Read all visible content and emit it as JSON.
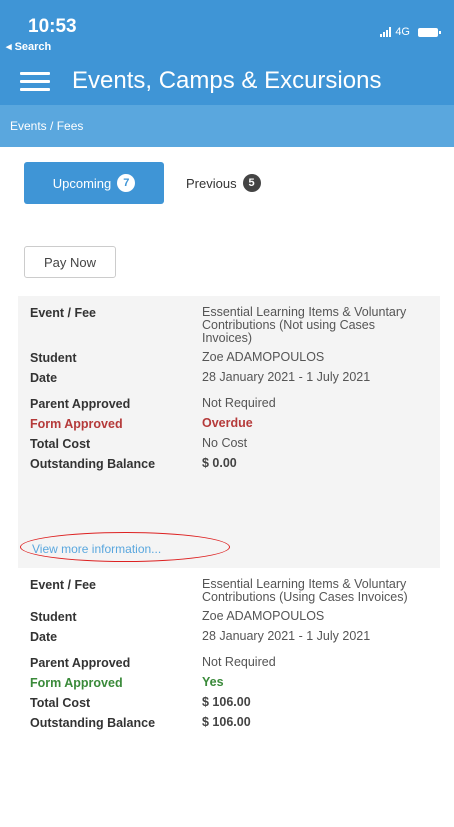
{
  "status": {
    "time": "10:53",
    "back": "◂ Search",
    "network": "4G"
  },
  "header": {
    "title": "Events, Camps & Excursions"
  },
  "breadcrumb": "Events / Fees",
  "tabs": {
    "upcoming": {
      "label": "Upcoming",
      "count": "7"
    },
    "previous": {
      "label": "Previous",
      "count": "5"
    }
  },
  "pay_now": "Pay Now",
  "labels": {
    "event": "Event / Fee",
    "student": "Student",
    "date": "Date",
    "parent": "Parent Approved",
    "form": "Form Approved",
    "cost": "Total Cost",
    "outstanding": "Outstanding Balance"
  },
  "items": [
    {
      "event": "Essential Learning Items & Voluntary Contributions (Not using Cases Invoices)",
      "student": "Zoe ADAMOPOULOS",
      "date": "28 January 2021 - 1 July 2021",
      "parent_approved": "Not Required",
      "form_approved": "Overdue",
      "total_cost": "No Cost",
      "outstanding": "$ 0.00",
      "more_link": "View more information..."
    },
    {
      "event": "Essential Learning Items & Voluntary Contributions (Using Cases Invoices)",
      "student": "Zoe ADAMOPOULOS",
      "date": "28 January 2021 - 1 July 2021",
      "parent_approved": "Not Required",
      "form_approved": "Yes",
      "total_cost": "$ 106.00",
      "outstanding": "$ 106.00"
    }
  ],
  "colors": {
    "primary": "#3f95d6",
    "breadcrumb_bg": "#5aa7de",
    "overdue": "#b53a3a",
    "approved": "#3a8a3a"
  }
}
